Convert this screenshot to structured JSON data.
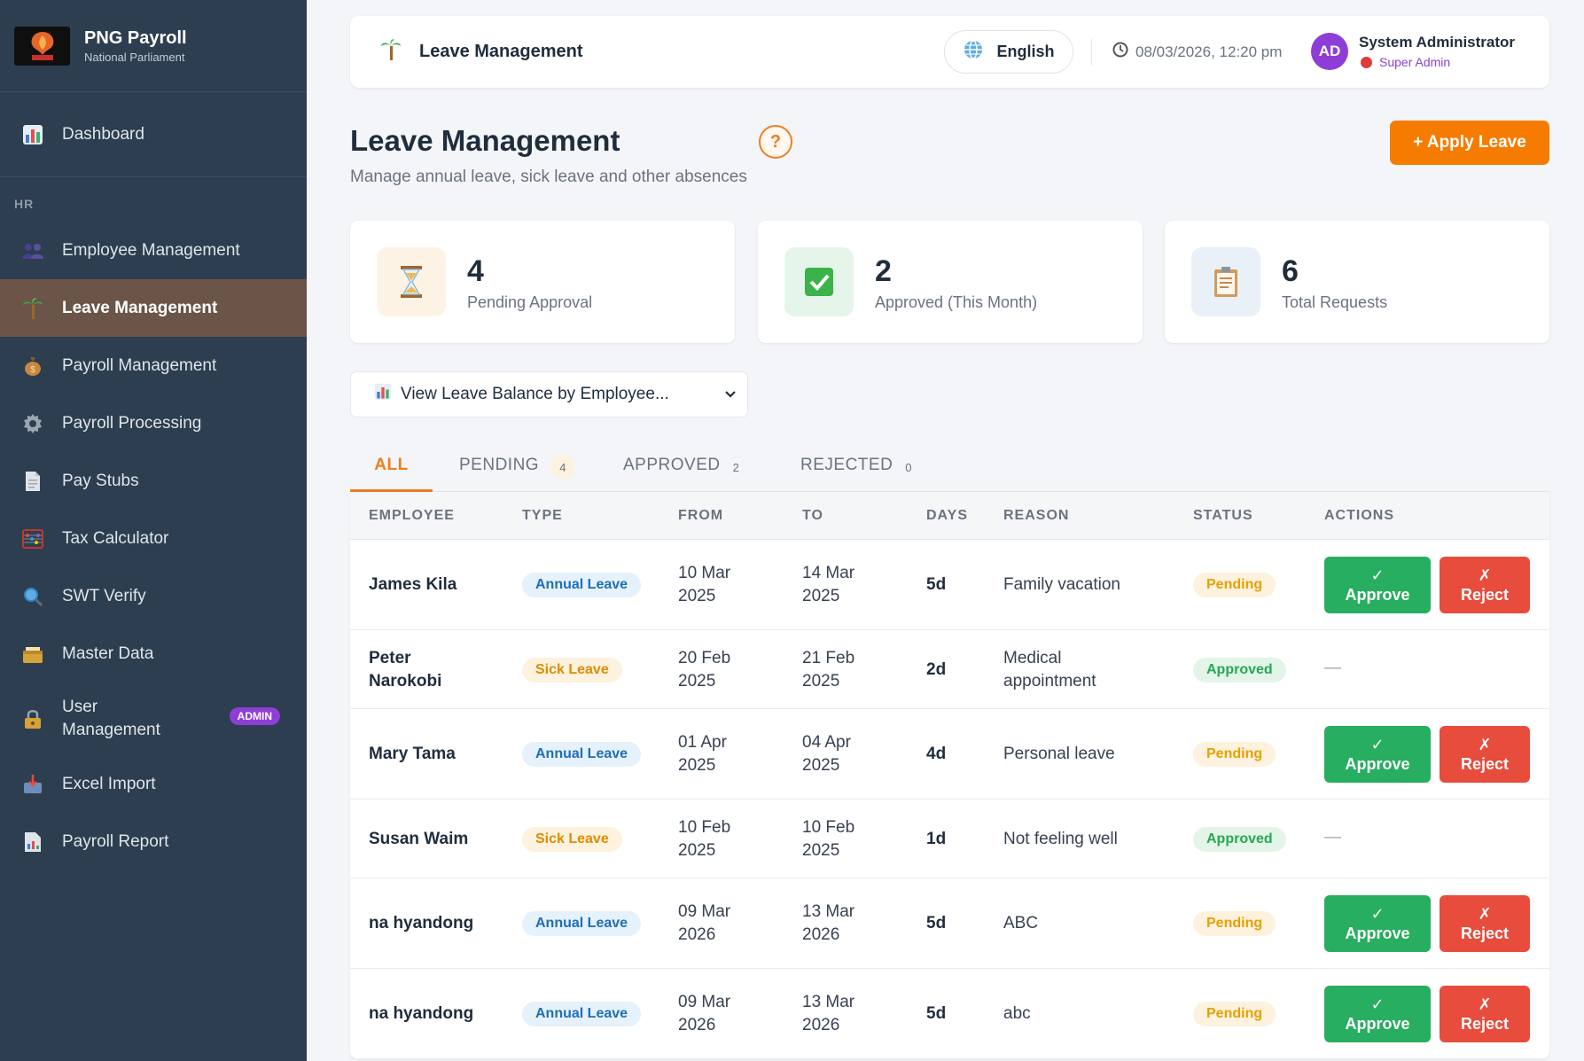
{
  "brand": {
    "title": "PNG Payroll",
    "subtitle": "National Parliament"
  },
  "sidebar": {
    "dashboard": "Dashboard",
    "section_hr": "HR",
    "items": [
      {
        "label": "Employee Management",
        "icon": "people-icon"
      },
      {
        "label": "Leave Management",
        "icon": "palm-tree-icon",
        "active": true
      },
      {
        "label": "Payroll Management",
        "icon": "money-bag-icon"
      },
      {
        "label": "Payroll Processing",
        "icon": "gear-icon"
      },
      {
        "label": "Pay Stubs",
        "icon": "document-icon"
      },
      {
        "label": "Tax Calculator",
        "icon": "abacus-icon"
      },
      {
        "label": "SWT Verify",
        "icon": "magnifier-icon"
      },
      {
        "label": "Master Data",
        "icon": "card-box-icon"
      },
      {
        "label": "User Management",
        "icon": "lock-icon",
        "badge": "ADMIN"
      },
      {
        "label": "Excel Import",
        "icon": "inbox-tray-icon"
      },
      {
        "label": "Payroll Report",
        "icon": "report-icon"
      }
    ]
  },
  "topbar": {
    "title": "Leave Management",
    "language": "English",
    "datetime": "08/03/2026, 12:20 pm",
    "avatar_initials": "AD",
    "user_name": "System Administrator",
    "user_role": "Super Admin"
  },
  "header": {
    "title": "Leave Management",
    "help": "?",
    "subtitle": "Manage annual leave, sick leave and other absences",
    "apply_button": "+ Apply Leave"
  },
  "stats": [
    {
      "value": "4",
      "label": "Pending Approval",
      "icon": "hourglass-icon"
    },
    {
      "value": "2",
      "label": "Approved (This Month)",
      "icon": "check-box-icon"
    },
    {
      "value": "6",
      "label": "Total Requests",
      "icon": "clipboard-icon"
    }
  ],
  "balance_select": {
    "selected": "View Leave Balance by Employee..."
  },
  "tabs": [
    {
      "label": "ALL",
      "count": ""
    },
    {
      "label": "PENDING",
      "count": "4"
    },
    {
      "label": "APPROVED",
      "count": "2"
    },
    {
      "label": "REJECTED",
      "count": "0"
    }
  ],
  "table": {
    "headers": [
      "EMPLOYEE",
      "TYPE",
      "FROM",
      "TO",
      "DAYS",
      "REASON",
      "STATUS",
      "ACTIONS"
    ],
    "approve_check": "✓",
    "approve_label": "Approve",
    "reject_x": "✗",
    "reject_label": "Reject",
    "no_action": "—",
    "rows": [
      {
        "employee": [
          "James Kila"
        ],
        "type": "Annual Leave",
        "from": [
          "10 Mar",
          "2025"
        ],
        "to": [
          "14 Mar",
          "2025"
        ],
        "days": "5d",
        "reason": [
          "Family vacation"
        ],
        "status": "Pending"
      },
      {
        "employee": [
          "Peter",
          "Narokobi"
        ],
        "type": "Sick Leave",
        "from": [
          "20 Feb",
          "2025"
        ],
        "to": [
          "21 Feb",
          "2025"
        ],
        "days": "2d",
        "reason": [
          "Medical",
          "appointment"
        ],
        "status": "Approved"
      },
      {
        "employee": [
          "Mary Tama"
        ],
        "type": "Annual Leave",
        "from": [
          "01 Apr",
          "2025"
        ],
        "to": [
          "04 Apr",
          "2025"
        ],
        "days": "4d",
        "reason": [
          "Personal leave"
        ],
        "status": "Pending"
      },
      {
        "employee": [
          "Susan Waim"
        ],
        "type": "Sick Leave",
        "from": [
          "10 Feb",
          "2025"
        ],
        "to": [
          "10 Feb",
          "2025"
        ],
        "days": "1d",
        "reason": [
          "Not feeling well"
        ],
        "status": "Approved"
      },
      {
        "employee": [
          "na hyandong"
        ],
        "type": "Annual Leave",
        "from": [
          "09 Mar",
          "2026"
        ],
        "to": [
          "13 Mar",
          "2026"
        ],
        "days": "5d",
        "reason": [
          "ABC"
        ],
        "status": "Pending"
      },
      {
        "employee": [
          "na hyandong"
        ],
        "type": "Annual Leave",
        "from": [
          "09 Mar",
          "2026"
        ],
        "to": [
          "13 Mar",
          "2026"
        ],
        "days": "5d",
        "reason": [
          "abc"
        ],
        "status": "Pending"
      }
    ]
  },
  "colors": {
    "sidebar": "#2d3e50",
    "active_nav": "#6b5548",
    "accent": "#f57c00",
    "approve": "#27ae60",
    "reject": "#e74c3c",
    "admin": "#8e3dd6"
  }
}
